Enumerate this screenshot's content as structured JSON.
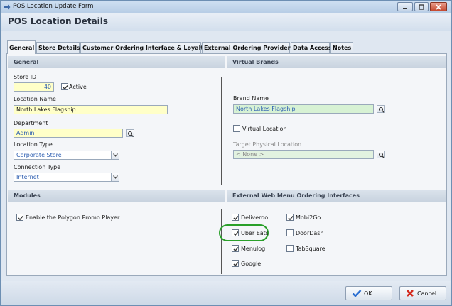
{
  "window": {
    "title": "POS Location Update Form",
    "header": "POS Location Details",
    "buttons": {
      "minimize": "minimize",
      "maximize": "maximize",
      "close": "close"
    }
  },
  "tabs": [
    {
      "label": "General",
      "active": true
    },
    {
      "label": "Store Details",
      "active": false
    },
    {
      "label": "Customer Ordering Interface & Loyalty",
      "active": false
    },
    {
      "label": "External Ordering Providers",
      "active": false
    },
    {
      "label": "Data Access",
      "active": false
    },
    {
      "label": "Notes",
      "active": false
    }
  ],
  "general": {
    "section_title": "General",
    "store_id_label": "Store ID",
    "store_id_value": "40",
    "active_label": "Active",
    "active_checked": true,
    "location_name_label": "Location Name",
    "location_name_value": "North Lakes Flagship",
    "department_label": "Department",
    "department_value": "Admin",
    "location_type_label": "Location Type",
    "location_type_value": "Corporate Store",
    "connection_type_label": "Connection Type",
    "connection_type_value": "Internet"
  },
  "virtual_brands": {
    "section_title": "Virtual Brands",
    "brand_name_label": "Brand Name",
    "brand_name_value": "North Lakes Flagship",
    "virtual_location_label": "Virtual Location",
    "virtual_location_checked": false,
    "target_physical_label": "Target Physical Location",
    "target_physical_value": "< None >"
  },
  "modules": {
    "section_title": "Modules",
    "polygon_label": "Enable the Polygon Promo Player",
    "polygon_checked": true
  },
  "external_web_menu": {
    "section_title": "External Web Menu Ordering Interfaces",
    "items": [
      {
        "label": "Deliveroo",
        "checked": true
      },
      {
        "label": "Mobi2Go",
        "checked": true
      },
      {
        "label": "Uber Eats",
        "checked": true
      },
      {
        "label": "DoorDash",
        "checked": false
      },
      {
        "label": "Menulog",
        "checked": true
      },
      {
        "label": "TabSquare",
        "checked": false
      },
      {
        "label": "Google",
        "checked": true
      }
    ]
  },
  "footer": {
    "ok_label": "OK",
    "cancel_label": "Cancel"
  },
  "colors": {
    "required_field": "#ffffc8",
    "brand_field": "#d7f2d4",
    "value_text": "#2a5cb0",
    "highlight": "#2aa02a",
    "ok_icon": "#2c6fd1",
    "cancel_icon": "#d42a1e"
  }
}
